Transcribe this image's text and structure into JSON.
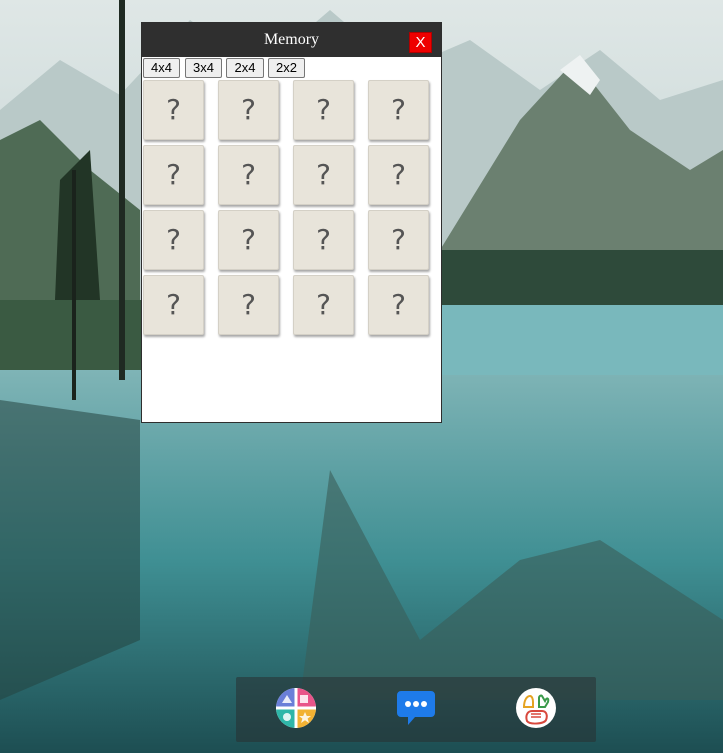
{
  "window": {
    "title": "Memory",
    "close_label": "X"
  },
  "grid_sizes": [
    "4x4",
    "3x4",
    "2x4",
    "2x2"
  ],
  "cards": [
    "?",
    "?",
    "?",
    "?",
    "?",
    "?",
    "?",
    "?",
    "?",
    "?",
    "?",
    "?",
    "?",
    "?",
    "?",
    "?"
  ],
  "dock": {
    "icons": [
      "shapes-app-icon",
      "chat-app-icon",
      "hands-app-icon"
    ]
  },
  "colors": {
    "titlebar": "#2f2f2f",
    "close_button": "#ee0000",
    "card_face": "#e8e4da"
  }
}
